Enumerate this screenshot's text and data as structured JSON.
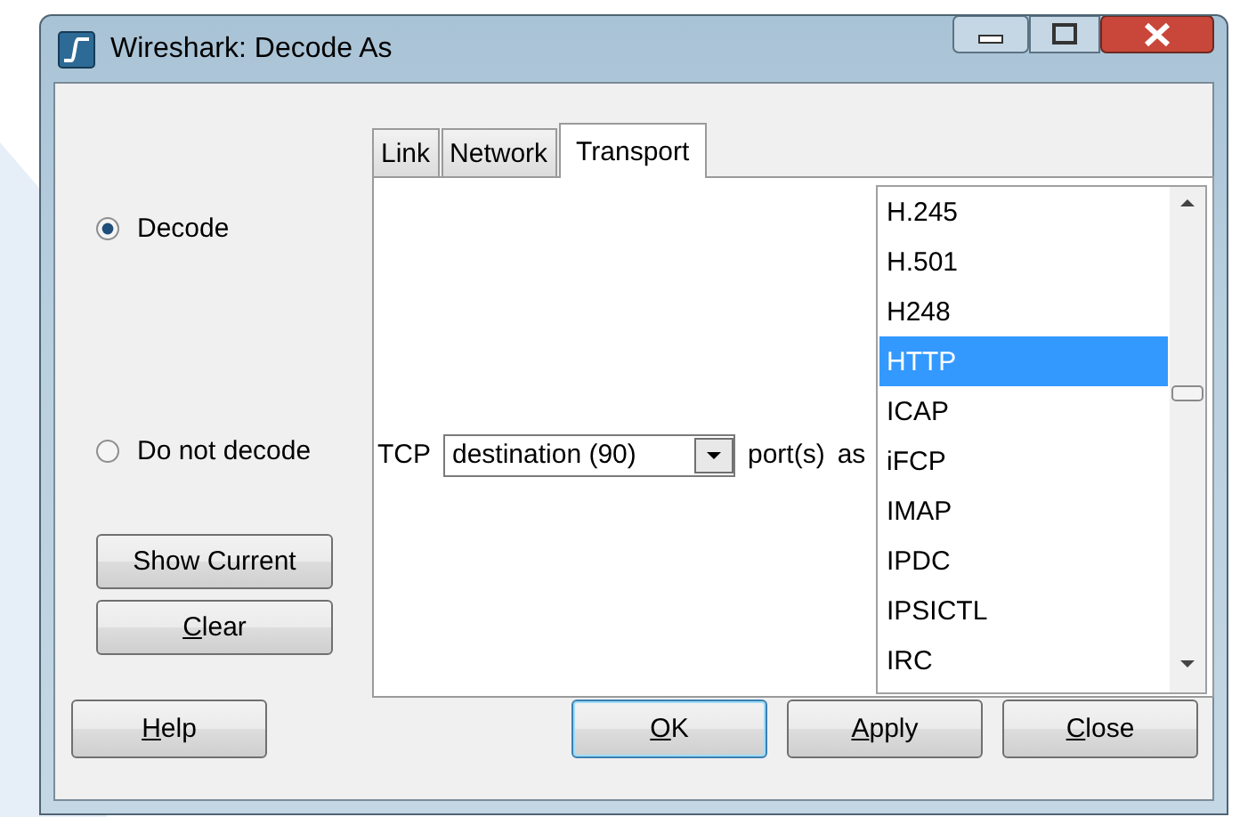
{
  "window": {
    "title": "Wireshark: Decode As"
  },
  "decode_options": [
    {
      "label": "Decode",
      "selected": true
    },
    {
      "label": "Do not decode",
      "selected": false
    }
  ],
  "side_buttons": [
    {
      "label": "Show Current",
      "underline_first": false
    },
    {
      "label": "Clear",
      "underline_first": true
    }
  ],
  "tabs": [
    {
      "label": "Link",
      "selected": false
    },
    {
      "label": "Network",
      "selected": false
    },
    {
      "label": "Transport",
      "selected": true
    }
  ],
  "transport": {
    "protocol_label": "TCP",
    "port_field": {
      "value": "destination (90)"
    },
    "port_suffix": "port(s)",
    "as_label": "as",
    "protocols": [
      {
        "label": "H.245",
        "selected": false
      },
      {
        "label": "H.501",
        "selected": false
      },
      {
        "label": "H248",
        "selected": false
      },
      {
        "label": "HTTP",
        "selected": true
      },
      {
        "label": "ICAP",
        "selected": false
      },
      {
        "label": "iFCP",
        "selected": false
      },
      {
        "label": "IMAP",
        "selected": false
      },
      {
        "label": "IPDC",
        "selected": false
      },
      {
        "label": "IPSICTL",
        "selected": false
      },
      {
        "label": "IRC",
        "selected": false
      }
    ]
  },
  "buttons": [
    {
      "label": "Help",
      "underline_first": true,
      "default": false
    },
    {
      "label": "OK",
      "underline_first": true,
      "default": true
    },
    {
      "label": "Apply",
      "underline_first": true,
      "default": false
    },
    {
      "label": "Close",
      "underline_first": true,
      "default": false
    }
  ]
}
